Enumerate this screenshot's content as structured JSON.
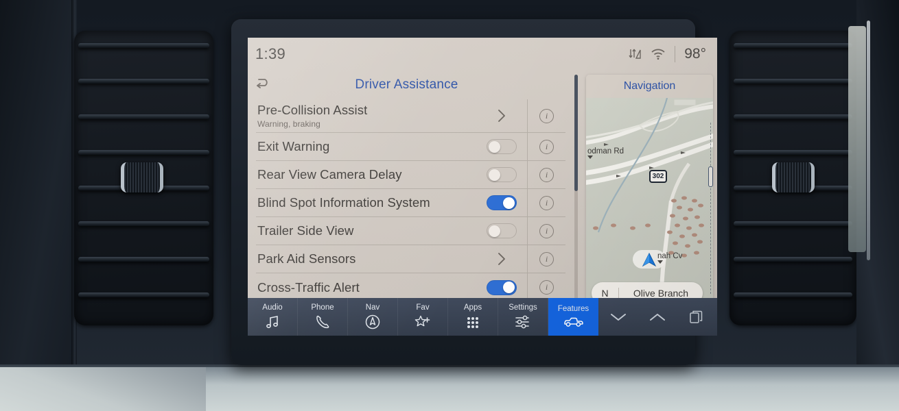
{
  "statusbar": {
    "clock": "1:39",
    "temperature": "98°",
    "icons": [
      "data-transfer-icon",
      "wifi-icon"
    ]
  },
  "header": {
    "back_icon": "back-arrow-icon",
    "title": "Driver Assistance"
  },
  "settings_list": [
    {
      "title": "Pre-Collision Assist",
      "subtitle": "Warning, braking",
      "control": "chevron",
      "info": "i"
    },
    {
      "title": "Exit Warning",
      "subtitle": "",
      "control": "toggle",
      "state": "off",
      "info": "i"
    },
    {
      "title": "Rear View Camera Delay",
      "subtitle": "",
      "control": "toggle",
      "state": "off",
      "info": "i"
    },
    {
      "title": "Blind Spot Information System",
      "subtitle": "",
      "control": "toggle",
      "state": "on",
      "info": "i"
    },
    {
      "title": "Trailer Side View",
      "subtitle": "",
      "control": "toggle",
      "state": "off",
      "info": "i"
    },
    {
      "title": "Park Aid Sensors",
      "subtitle": "",
      "control": "chevron",
      "info": "i"
    },
    {
      "title": "Cross-Traffic Alert",
      "subtitle": "",
      "control": "toggle",
      "state": "on",
      "info": "i"
    }
  ],
  "navigation": {
    "title": "Navigation",
    "street_label": "odman Rd",
    "street_label_2": "nah Cv",
    "highway_shield": "302",
    "direction": "N",
    "destination": "Olive Branch"
  },
  "taskbar": {
    "items": [
      {
        "label": "Audio",
        "icon": "music-note-icon",
        "active": false
      },
      {
        "label": "Phone",
        "icon": "phone-icon",
        "active": false
      },
      {
        "label": "Nav",
        "icon": "compass-icon",
        "active": false
      },
      {
        "label": "Fav",
        "icon": "star-plus-icon",
        "active": false
      },
      {
        "label": "Apps",
        "icon": "grid-icon",
        "active": false
      },
      {
        "label": "Settings",
        "icon": "sliders-icon",
        "active": false
      },
      {
        "label": "Features",
        "icon": "truck-icon",
        "active": true
      }
    ],
    "controls": [
      {
        "icon": "chevron-down-icon"
      },
      {
        "icon": "chevron-up-icon"
      },
      {
        "icon": "windows-layers-icon"
      }
    ]
  },
  "colors": {
    "accent_blue": "#2f54a8",
    "toggle_on": "#2f6fd4",
    "tile_active": "#1565e0",
    "screen_bg": "#d6cfc8",
    "taskbar_bg": "#38414f"
  }
}
